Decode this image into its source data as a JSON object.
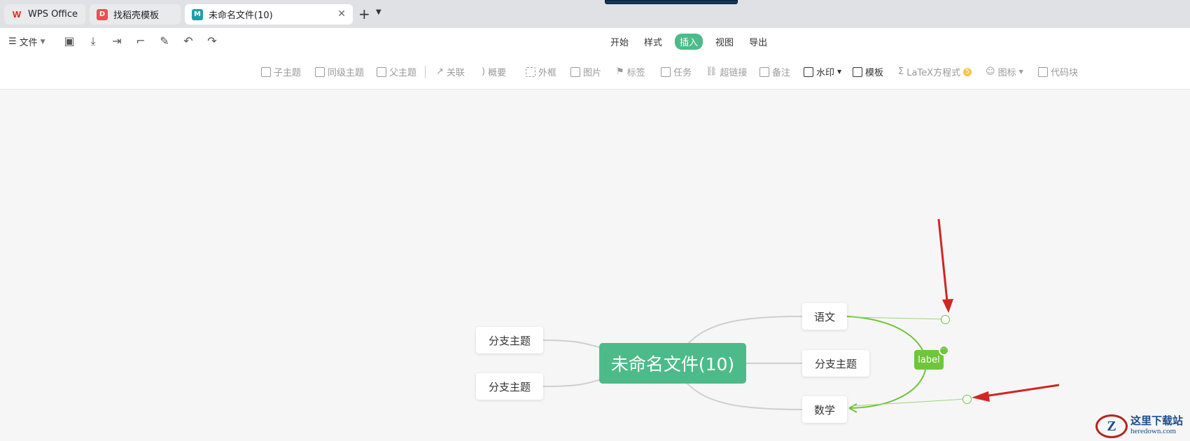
{
  "tabs": [
    {
      "label": "WPS Office",
      "icon": "wps-logo-icon"
    },
    {
      "label": "找稻壳模板",
      "icon": "docer-icon"
    },
    {
      "label": "未命名文件(10)",
      "icon": "mindmap-doc-icon",
      "active": true
    }
  ],
  "menubar": {
    "file_label": "文件",
    "tabs": [
      "开始",
      "样式",
      "插入",
      "视图",
      "导出"
    ],
    "active_tab": "插入"
  },
  "ribbon": {
    "items": [
      "子主题",
      "同级主题",
      "父主题",
      "关联",
      "概要",
      "外框",
      "图片",
      "标签",
      "任务",
      "超链接",
      "备注",
      "水印",
      "模板",
      "LaTeX方程式",
      "图标",
      "代码块"
    ],
    "latex_badge": "5"
  },
  "mindmap": {
    "root": "未命名文件(10)",
    "left_branches": [
      "分支主题",
      "分支主题"
    ],
    "right_branches": [
      "语文",
      "分支主题",
      "数学"
    ],
    "relation_label": "label",
    "relation_more": "⋯"
  },
  "watermark": {
    "cn": "这里下载站",
    "en": "heredown.com",
    "logo": "Z"
  },
  "colors": {
    "accent": "#4dbb89",
    "relation": "#6fc53b",
    "arrow": "#d22424"
  }
}
